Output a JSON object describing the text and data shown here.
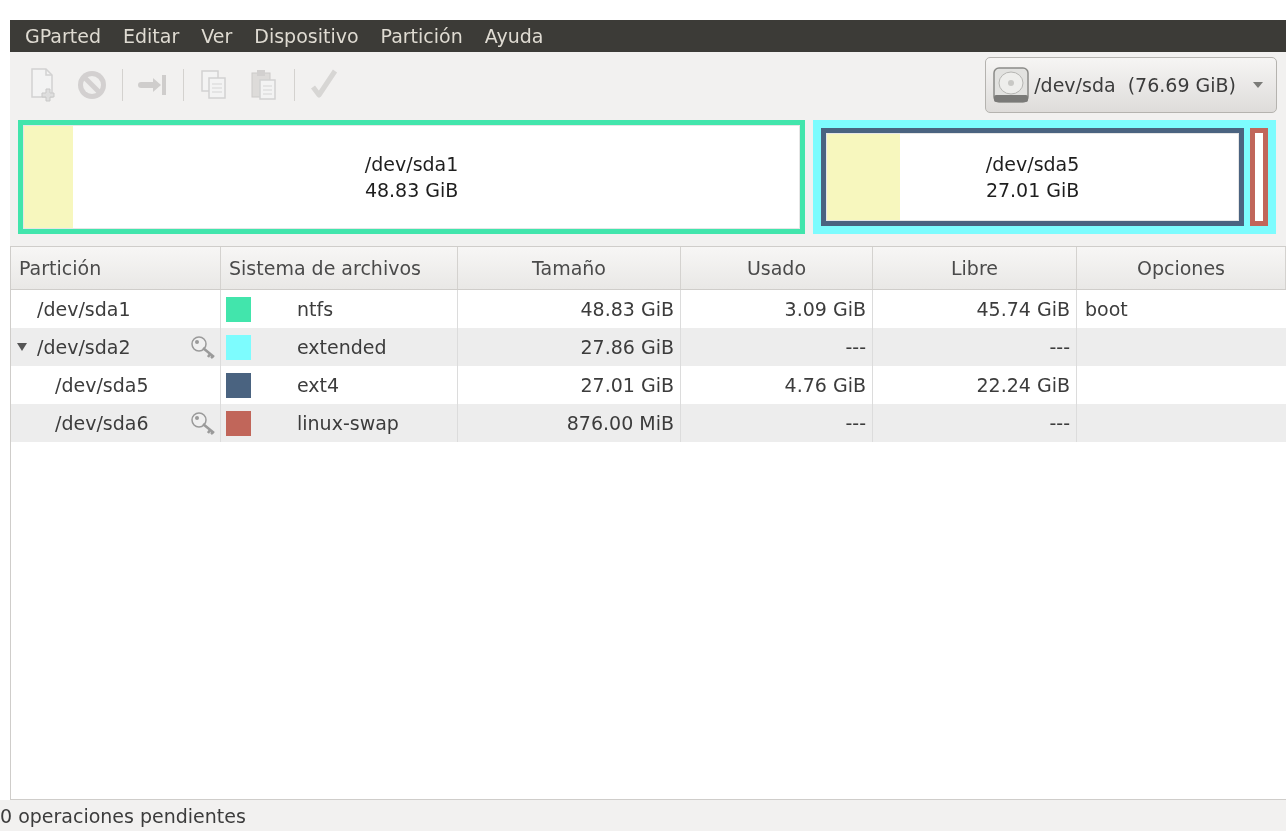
{
  "menu": [
    "GParted",
    "Editar",
    "Ver",
    "Dispositivo",
    "Partición",
    "Ayuda"
  ],
  "toolbar": [
    [
      {
        "kind": "new",
        "disabled": true
      },
      {
        "kind": "delete",
        "disabled": true
      }
    ],
    [
      {
        "kind": "resize",
        "disabled": true
      }
    ],
    [
      {
        "kind": "copy",
        "disabled": true
      },
      {
        "kind": "paste",
        "disabled": true
      }
    ],
    [
      {
        "kind": "apply",
        "disabled": true
      }
    ]
  ],
  "device": {
    "label": "/dev/sda  (76.69 GiB)"
  },
  "disk_map": [
    {
      "kind": "primary",
      "name": "/dev/sda1",
      "size": "48.83 GiB",
      "color": "#42e5ac",
      "level": 0.063
    },
    {
      "kind": "extended",
      "color": "#7dfcfe",
      "children": [
        {
          "kind": "logical",
          "name": "/dev/sda5",
          "size": "27.01 GiB",
          "color": "#4a6380",
          "level": 0.176
        },
        {
          "kind": "logical",
          "color": "#c1665a"
        }
      ]
    }
  ],
  "table": {
    "columns": [
      "Partición",
      "Sistema de archivos",
      "Tamaño",
      "Usado",
      "Libre",
      "Opciones"
    ],
    "rows": [
      {
        "partition": "/dev/sda1",
        "busy": false,
        "color": "#42e5ac",
        "filesystem": "ntfs",
        "size": "48.83 GiB",
        "used": "3.09 GiB",
        "free": "45.74 GiB",
        "flags": "boot"
      },
      {
        "partition": "/dev/sda2",
        "busy": true,
        "expanded": true,
        "color": "#7dfcfe",
        "filesystem": "extended",
        "size": "27.86 GiB",
        "used": "---",
        "free": "---",
        "children": [
          {
            "partition": "/dev/sda5",
            "busy": false,
            "color": "#4a6380",
            "filesystem": "ext4",
            "size": "27.01 GiB",
            "used": "4.76 GiB",
            "free": "22.24 GiB"
          },
          {
            "partition": "/dev/sda6",
            "busy": true,
            "color": "#c1665a",
            "filesystem": "linux-swap",
            "size": "876.00 MiB",
            "used": "---",
            "free": "---"
          }
        ]
      }
    ]
  },
  "status_bar": "0 operaciones pendientes"
}
